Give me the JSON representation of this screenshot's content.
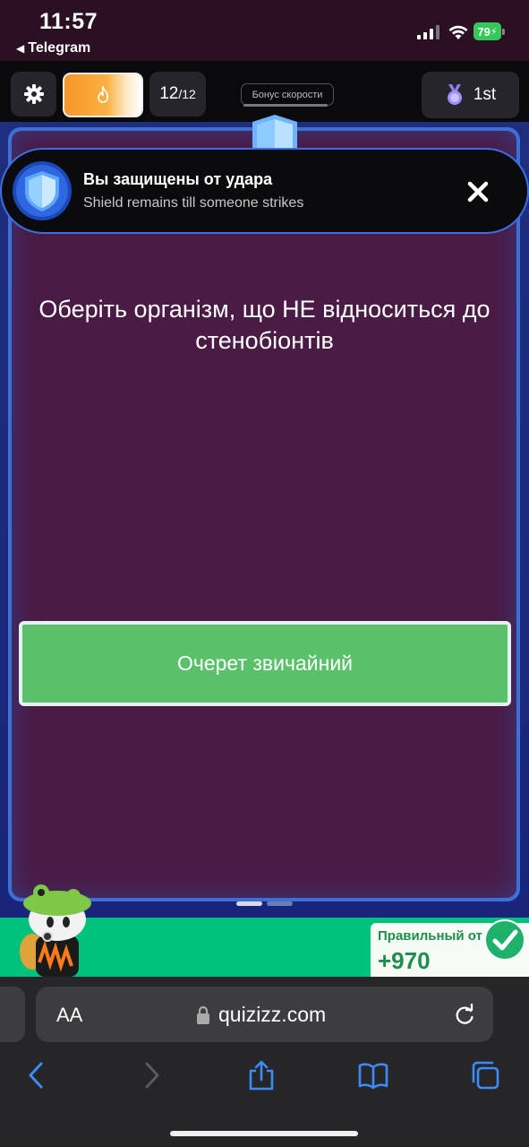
{
  "status_bar": {
    "time": "11:57",
    "back_app": "Telegram",
    "battery": "79"
  },
  "game_bar": {
    "question_counter_current": "12",
    "question_counter_total": "/12",
    "speed_bonus_label": "Бонус скорости",
    "rank": "1st",
    "streak_level": 0.85
  },
  "toast": {
    "title": "Вы защищены от удара",
    "subtitle": "Shield remains till someone strikes"
  },
  "question": {
    "text": "Оберіть організм, що НЕ відноситься до стенобіонтів"
  },
  "answers": [
    {
      "label": "Очерет звичайний"
    }
  ],
  "feedback": {
    "label": "Правильный от",
    "points": "+970"
  },
  "browser": {
    "aa_label": "AA",
    "url": "quizizz.com"
  },
  "colors": {
    "answer_green": "#5bc06a",
    "panel_purple": "#4a1b44",
    "frame_blue": "#3e6fd6",
    "bar_green": "#00c27a",
    "streak_orange": "#f7962a"
  }
}
